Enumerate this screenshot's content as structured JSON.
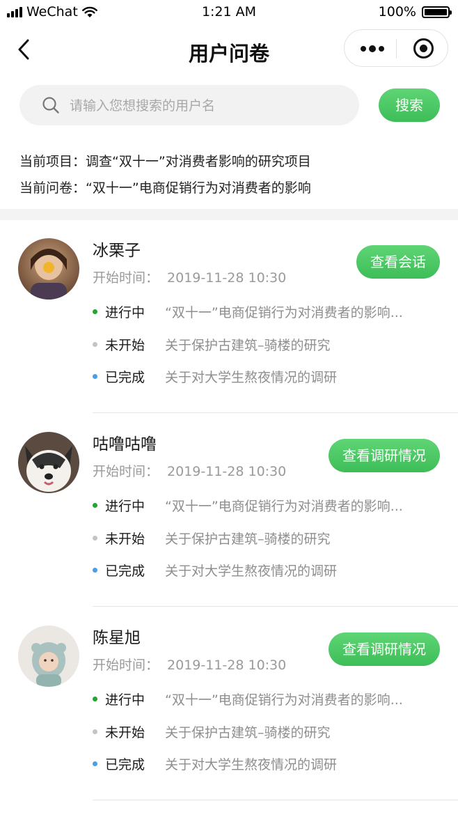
{
  "status_bar": {
    "carrier": "WeChat",
    "time": "1:21 AM",
    "battery": "100%"
  },
  "nav": {
    "title": "用户问卷"
  },
  "search": {
    "placeholder": "请输入您想搜索的用户名",
    "button_label": "搜索"
  },
  "project": {
    "label": "当前项目：",
    "value": "调查“双十一”对消费者影响的研究项目",
    "questionnaire_label": "当前问卷：",
    "questionnaire_value": "“双十一”电商促销行为对消费者的影响"
  },
  "status_colors": {
    "in_progress": "#1fa82d",
    "not_started": "#c4c4c4",
    "done": "#4a9ee6"
  },
  "users": [
    {
      "name": "冰栗子",
      "start_label": "开始时间：",
      "start_time": "2019-11-28   10:30",
      "button": "查看会话",
      "avatar": "photo-avatar-girl",
      "items": [
        {
          "status": "进行中",
          "survey": "“双十一”电商促销行为对消费者的影响..."
        },
        {
          "status": "未开始",
          "survey": "关于保护古建筑–骑楼的研究"
        },
        {
          "status": "已完成",
          "survey": "关于对大学生熬夜情况的调研"
        }
      ]
    },
    {
      "name": "咕噜咕噜",
      "start_label": "开始时间：",
      "start_time": "2019-11-28   10:30",
      "button": "查看调研情况",
      "avatar": "photo-avatar-husky",
      "items": [
        {
          "status": "进行中",
          "survey": "“双十一”电商促销行为对消费者的影响..."
        },
        {
          "status": "未开始",
          "survey": "关于保护古建筑–骑楼的研究"
        },
        {
          "status": "已完成",
          "survey": "关于对大学生熬夜情况的调研"
        }
      ]
    },
    {
      "name": "陈星旭",
      "start_label": "开始时间：",
      "start_time": "2019-11-28   10:30",
      "button": "查看调研情况",
      "avatar": "photo-avatar-baby",
      "items": [
        {
          "status": "进行中",
          "survey": "“双十一”电商促销行为对消费者的影响..."
        },
        {
          "status": "未开始",
          "survey": "关于保护古建筑–骑楼的研究"
        },
        {
          "status": "已完成",
          "survey": "关于对大学生熬夜情况的调研"
        }
      ]
    }
  ]
}
